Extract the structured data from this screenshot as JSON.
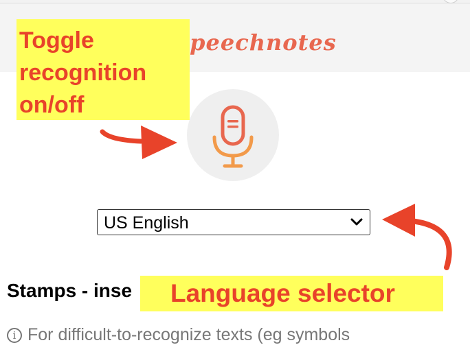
{
  "app": {
    "brand": "Speechnotes"
  },
  "mic_button": {
    "icon": "microphone-icon",
    "accent": "#e8674f",
    "accent2": "#f29a4a"
  },
  "language_select": {
    "value": "US English",
    "icon": "chevron-down-icon"
  },
  "section": {
    "heading": "Stamps - inse",
    "info_text": "For difficult-to-recognize texts (eg symbols"
  },
  "annotations": {
    "toggle": [
      "Toggle",
      "recognition",
      "on/off"
    ],
    "language": "Language selector",
    "callout_bg": "#ffff5c",
    "callout_fg": "#e8432a"
  }
}
